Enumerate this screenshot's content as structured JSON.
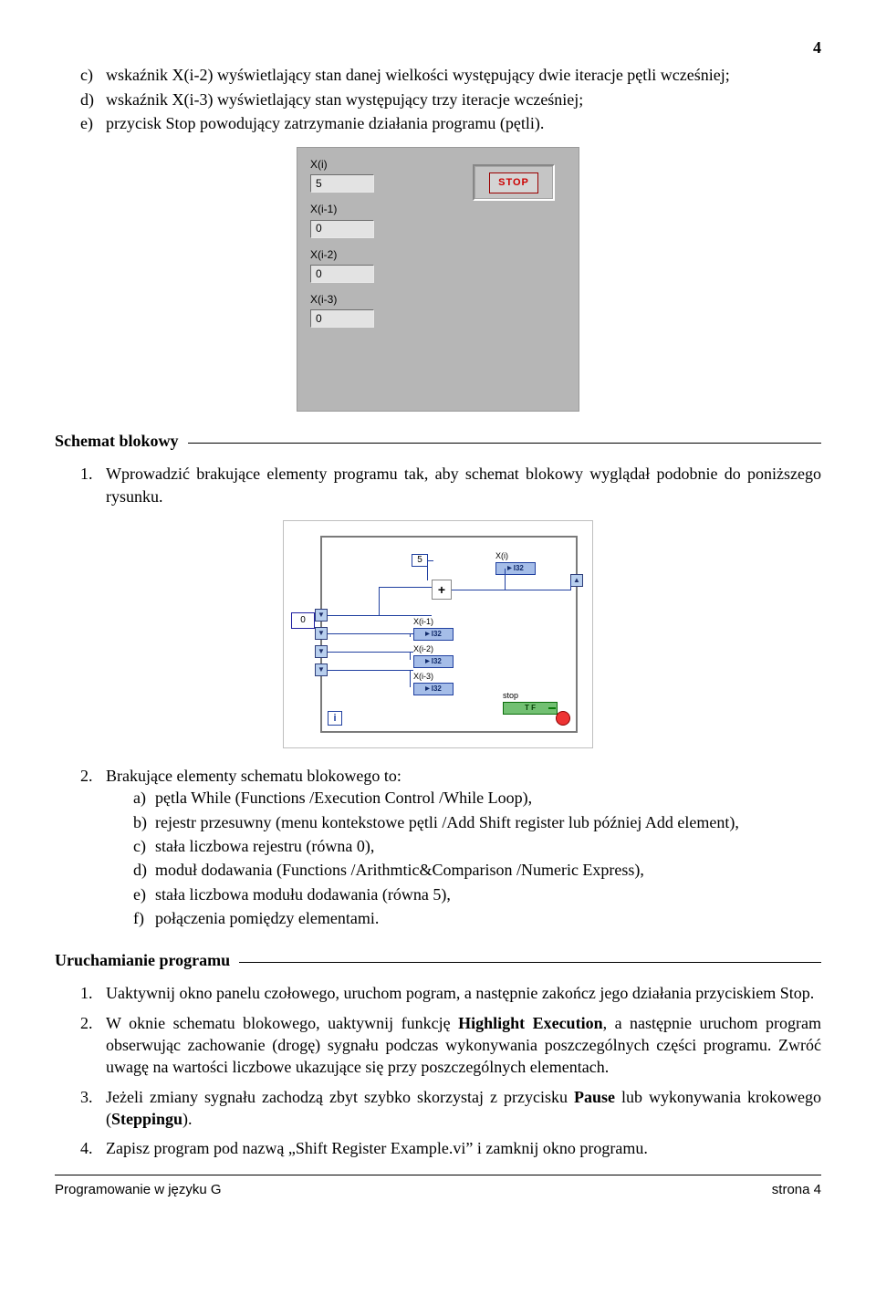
{
  "pageNumber": "4",
  "introList": {
    "c": {
      "marker": "c)",
      "text": "wskaźnik X(i-2) wyświetlający stan danej wielkości występujący dwie iteracje pętli wcześniej;"
    },
    "d": {
      "marker": "d)",
      "text": "wskaźnik X(i-3) wyświetlający stan występujący trzy iteracje wcześniej;"
    },
    "e": {
      "marker": "e)",
      "text": "przycisk Stop powodujący zatrzymanie działania programu (pętli)."
    }
  },
  "frontPanel": {
    "labels": {
      "xi": "X(i)",
      "xi1": "X(i-1)",
      "xi2": "X(i-2)",
      "xi3": "X(i-3)"
    },
    "values": {
      "xi": "5",
      "xi1": "0",
      "xi2": "0",
      "xi3": "0"
    },
    "stop": "STOP"
  },
  "section1": {
    "title": "Schemat blokowy"
  },
  "schematList": {
    "1": {
      "marker": "1.",
      "text": "Wprowadzić brakujące elementy programu tak, aby schemat blokowy wyglądał podobnie do poniższego rysunku."
    },
    "2": {
      "marker": "2.",
      "text": "Brakujące elementy schematu blokowego to:",
      "sub": {
        "a": {
          "marker": "a)",
          "text": "pętla While (Functions /Execution Control /While Loop),"
        },
        "b": {
          "marker": "b)",
          "text": "rejestr przesuwny (menu kontekstowe pętli /Add Shift register lub później Add element),"
        },
        "c": {
          "marker": "c)",
          "text": "stała liczbowa rejestru (równa 0),"
        },
        "d": {
          "marker": "d)",
          "text": "moduł dodawania (Functions /Arithmtic&Comparison /Numeric Express),"
        },
        "e": {
          "marker": "e)",
          "text": "stała liczbowa modułu dodawania (równa 5),"
        },
        "f": {
          "marker": "f)",
          "text": "połączenia pomiędzy elementami."
        }
      }
    }
  },
  "blockDiagram": {
    "const0": "0",
    "const5": "5",
    "add": "+",
    "i32": "I32",
    "iter": "i",
    "labels": {
      "xi": "X(i)",
      "xi1": "X(i-1)",
      "xi2": "X(i-2)",
      "xi3": "X(i-3)",
      "stop": "stop"
    },
    "tf": "T F"
  },
  "section2": {
    "title": "Uruchamianie programu"
  },
  "runList": {
    "1": {
      "marker": "1.",
      "text": "Uaktywnij okno panelu czołowego, uruchom pogram, a następnie zakończ jego działania przyciskiem Stop."
    },
    "2": {
      "marker": "2.",
      "text": "W oknie schematu blokowego, uaktywnij funkcję ",
      "bold": "Highlight Execution",
      "rest": ", a następnie uruchom program obserwując zachowanie (drogę) sygnału podczas wykonywania poszczególnych części programu. Zwróć uwagę na wartości liczbowe ukazujące się przy poszczególnych elementach."
    },
    "3": {
      "marker": "3.",
      "text": "Jeżeli zmiany sygnału zachodzą zbyt szybko skorzystaj z przycisku ",
      "bold": "Pause",
      "rest": " lub wykonywania krokowego (",
      "bold2": "Steppingu",
      "rest2": ")."
    },
    "4": {
      "marker": "4.",
      "text": "Zapisz program pod nazwą „Shift Register Example.vi” i zamknij okno programu."
    }
  },
  "footer": {
    "left": "Programowanie w języku G",
    "right": "strona 4"
  }
}
